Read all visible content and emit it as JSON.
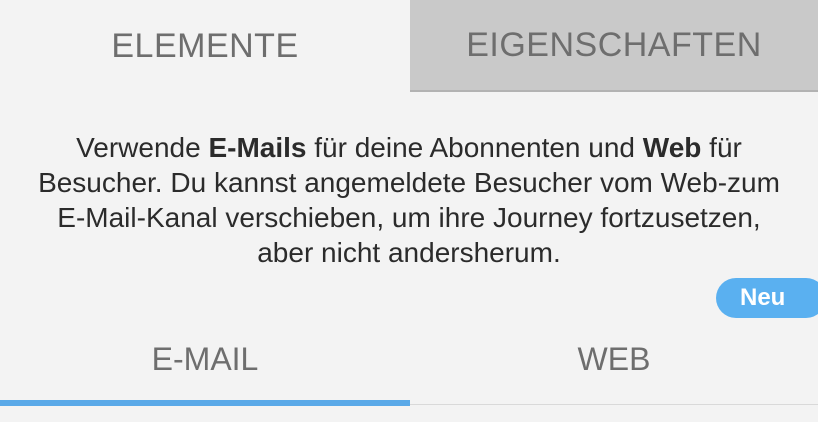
{
  "top_tabs": {
    "elements_label": "ELEMENTE",
    "properties_label": "EIGENSCHAFTEN"
  },
  "description": {
    "part1": "Verwende ",
    "bold1": "E-Mails",
    "part2": " für deine Abonnenten und ",
    "bold2": "Web",
    "part3": " für Besucher. Du kannst angemeldete Besucher vom Web-zum E-Mail-Kanal verschieben, um ihre Journey fortzusetzen, aber nicht andersherum."
  },
  "channel_tabs": {
    "email_label": "E-MAIL",
    "web_label": "WEB",
    "selected": "E-MAIL"
  },
  "badge": {
    "label": "Neu"
  },
  "colors": {
    "accent": "#5aa9e8",
    "badge": "#5ab0f0",
    "inactive_tab": "#c9c9c9",
    "background": "#f3f3f3"
  }
}
